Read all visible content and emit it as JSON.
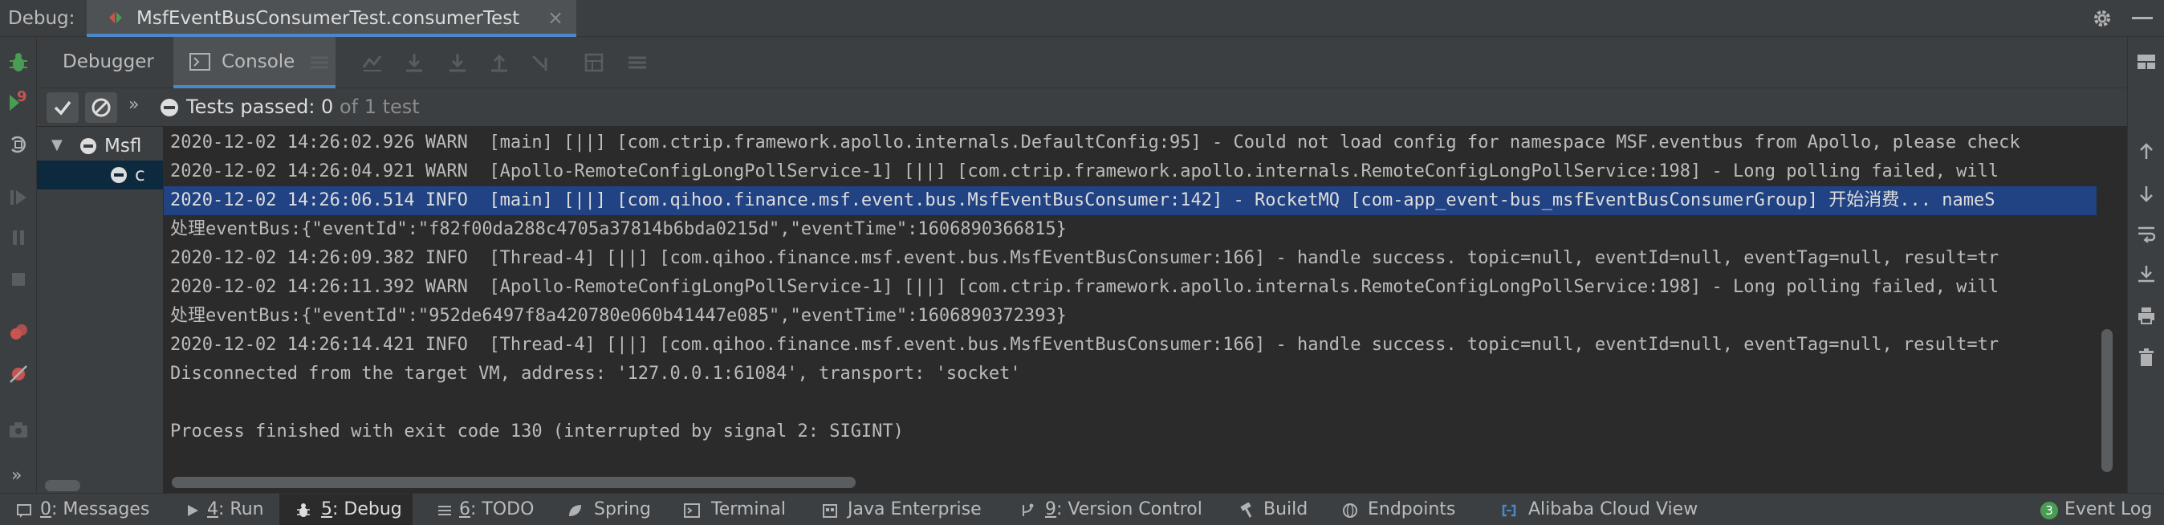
{
  "titlebar": {
    "debug_label": "Debug:",
    "tab_title": "MsfEventBusConsumerTest.consumerTest",
    "tab_close": "×"
  },
  "subtabs": {
    "debugger": "Debugger",
    "console": "Console"
  },
  "tests": {
    "passed_label": "Tests passed: 0",
    "of_total": "of 1 test"
  },
  "tree": {
    "root_label": "Msfl",
    "child_label": "c"
  },
  "console": {
    "lines": [
      "2020-12-02 14:26:02.926 WARN  [main] [||] [com.ctrip.framework.apollo.internals.DefaultConfig:95] - Could not load config for namespace MSF.eventbus from Apollo, please check",
      "2020-12-02 14:26:04.921 WARN  [Apollo-RemoteConfigLongPollService-1] [||] [com.ctrip.framework.apollo.internals.RemoteConfigLongPollService:198] - Long polling failed, will",
      "2020-12-02 14:26:06.514 INFO  [main] [||] [com.qihoo.finance.msf.event.bus.MsfEventBusConsumer:142] - RocketMQ [com-app_event-bus_msfEventBusConsumerGroup] 开始消费... nameS",
      "处理eventBus:{\"eventId\":\"f82f00da288c4705a37814b6bda0215d\",\"eventTime\":1606890366815}",
      "2020-12-02 14:26:09.382 INFO  [Thread-4] [||] [com.qihoo.finance.msf.event.bus.MsfEventBusConsumer:166] - handle success. topic=null, eventId=null, eventTag=null, result=tr",
      "2020-12-02 14:26:11.392 WARN  [Apollo-RemoteConfigLongPollService-1] [||] [com.ctrip.framework.apollo.internals.RemoteConfigLongPollService:198] - Long polling failed, will",
      "处理eventBus:{\"eventId\":\"952de6497f8a420780e060b41447e085\",\"eventTime\":1606890372393}",
      "2020-12-02 14:26:14.421 INFO  [Thread-4] [||] [com.qihoo.finance.msf.event.bus.MsfEventBusConsumer:166] - handle success. topic=null, eventId=null, eventTag=null, result=tr",
      "Disconnected from the target VM, address: '127.0.0.1:61084', transport: 'socket'",
      "",
      "Process finished with exit code 130 (interrupted by signal 2: SIGINT)"
    ]
  },
  "bottombar": {
    "messages": {
      "num": "0",
      "text": ": Messages"
    },
    "run": {
      "num": "4",
      "text": ": Run"
    },
    "debug": {
      "num": "5",
      "text": ": Debug"
    },
    "todo": {
      "num": "6",
      "text": ": TODO"
    },
    "spring": "Spring",
    "terminal": "Terminal",
    "java_enterprise": "Java Enterprise",
    "vcs": {
      "num": "9",
      "text": ": Version Control"
    },
    "build": "Build",
    "endpoints": "Endpoints",
    "alibaba": "Alibaba Cloud View",
    "event_log_count": "3",
    "event_log": "Event Log"
  },
  "badges": {
    "rerun_count": "9"
  },
  "colors": {
    "accent": "#4a88c7",
    "selection": "#214283",
    "green": "#499c54",
    "red": "#c75450"
  }
}
